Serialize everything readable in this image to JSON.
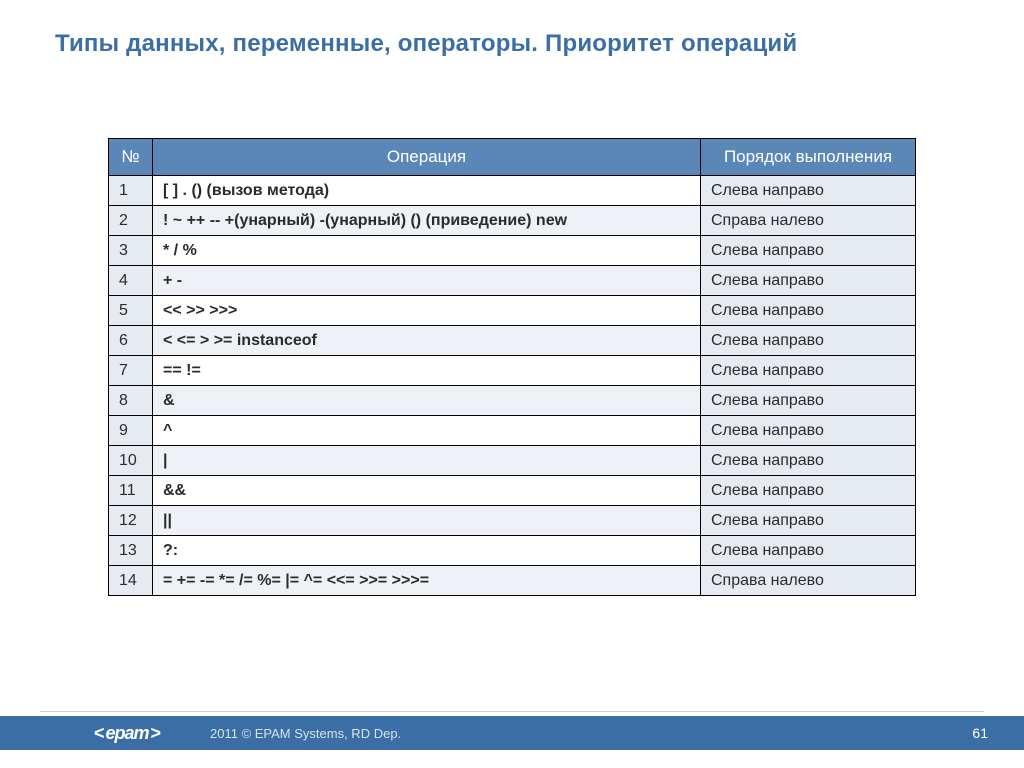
{
  "title": "Типы данных, переменные, операторы. Приоритет операций",
  "headers": {
    "num": "№",
    "op": "Операция",
    "order": "Порядок выполнения"
  },
  "rows": [
    {
      "n": "1",
      "op": "[ ]   .   () (вызов метода)",
      "ord": "Слева направо"
    },
    {
      "n": "2",
      "op": "! ~ ++ -- +(унарный)  -(унарный) () (приведение) new",
      "ord": "Справа налево"
    },
    {
      "n": "3",
      "op": "*  /   %",
      "ord": "Слева направо"
    },
    {
      "n": "4",
      "op": "+ -",
      "ord": "Слева направо"
    },
    {
      "n": "5",
      "op": "<< >> >>>",
      "ord": "Слева направо"
    },
    {
      "n": "6",
      "op": "< <= > >= instanceof",
      "ord": "Слева направо"
    },
    {
      "n": "7",
      "op": "== !=",
      "ord": "Слева направо"
    },
    {
      "n": "8",
      "op": "&",
      "ord": "Слева направо"
    },
    {
      "n": "9",
      "op": "^",
      "ord": "Слева направо"
    },
    {
      "n": "10",
      "op": "|",
      "ord": "Слева направо"
    },
    {
      "n": "11",
      "op": "&&",
      "ord": "Слева направо"
    },
    {
      "n": "12",
      "op": "||",
      "ord": "Слева направо"
    },
    {
      "n": "13",
      "op": "?:",
      "ord": "Слева направо"
    },
    {
      "n": "14",
      "op": "= += -= *= /= %= |= ^= <<= >>= >>>=",
      "ord": "Справа налево"
    }
  ],
  "footer": {
    "logo": "epam",
    "dep": "2011 © EPAM Systems, RD Dep.",
    "page": "61"
  }
}
